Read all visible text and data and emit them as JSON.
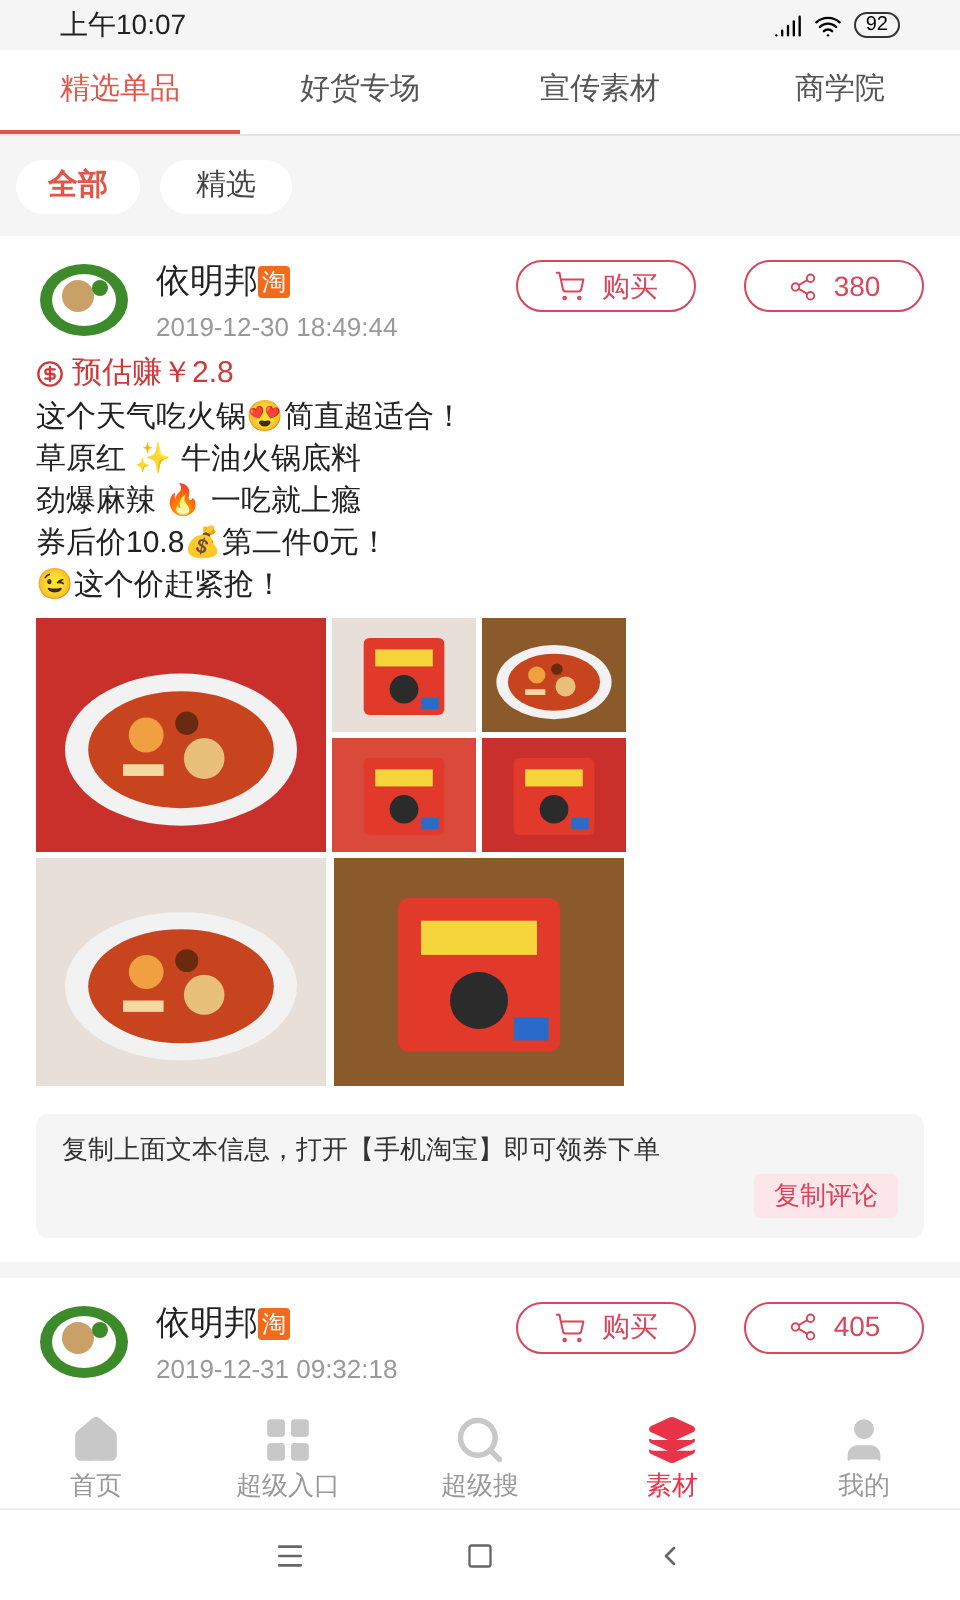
{
  "status_bar": {
    "time": "上午10:07",
    "battery": "92"
  },
  "tabs": [
    {
      "label": "精选单品",
      "selected": true
    },
    {
      "label": "好货专场",
      "selected": false
    },
    {
      "label": "宣传素材",
      "selected": false
    },
    {
      "label": "商学院",
      "selected": false
    }
  ],
  "filters": [
    {
      "label": "全部",
      "selected": true
    },
    {
      "label": "精选",
      "selected": false
    }
  ],
  "posts": [
    {
      "author": "依明邦",
      "badge": "淘",
      "time": "2019-12-30 18:49:44",
      "buy": "购买",
      "shares": "380",
      "earn": "预估赚￥2.8",
      "lines": [
        "这个天气吃火锅😍简直超适合！",
        "草原红 ✨ 牛油火锅底料",
        "劲爆麻辣 🔥 一吃就上瘾",
        "券后价10.8💰第二件0元！",
        "😉这个价赶紧抢！"
      ],
      "note": "复制上面文本信息，打开【手机淘宝】即可领券下单",
      "copy_button": "复制评论"
    },
    {
      "author": "依明邦",
      "badge": "淘",
      "time": "2019-12-31 09:32:18",
      "buy": "购买",
      "shares": "405"
    }
  ],
  "bottom_nav": [
    {
      "label": "首页",
      "kind": "home",
      "selected": false
    },
    {
      "label": "超级入口",
      "kind": "grid",
      "selected": false
    },
    {
      "label": "超级搜",
      "kind": "search",
      "selected": false
    },
    {
      "label": "素材",
      "kind": "layers",
      "selected": true
    },
    {
      "label": "我的",
      "kind": "user",
      "selected": false
    }
  ]
}
